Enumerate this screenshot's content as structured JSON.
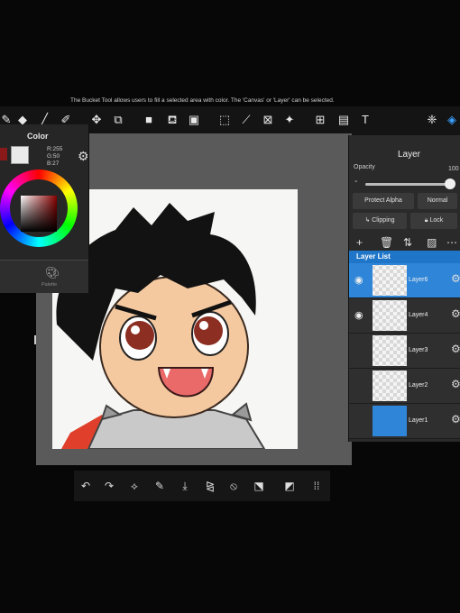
{
  "hint": "The Bucket Tool allows users to fill a selected area with color. The 'Canvas' or 'Layer' can be selected.",
  "color_panel": {
    "title": "Color",
    "rgb": [
      "R:255",
      "G:50",
      "B:27"
    ],
    "palette_label": "Palette"
  },
  "layer_panel": {
    "title": "Layer",
    "opacity_label": "Opacity",
    "opacity_value": "100",
    "protect_alpha": "Protect Alpha",
    "blend_mode": "Normal",
    "clipping": "Clipping",
    "lock": "Lock",
    "list_label": "Layer List",
    "layers": [
      {
        "name": "Layer6",
        "selected": true
      },
      {
        "name": "Layer4",
        "selected": false
      },
      {
        "name": "Layer3",
        "selected": false
      },
      {
        "name": "Layer2",
        "selected": false
      },
      {
        "name": "Layer1",
        "selected": false
      }
    ]
  },
  "colors": {
    "accent": "#2f86d8",
    "panel": "#2a2a2a",
    "brush": "#8a1a1a"
  }
}
